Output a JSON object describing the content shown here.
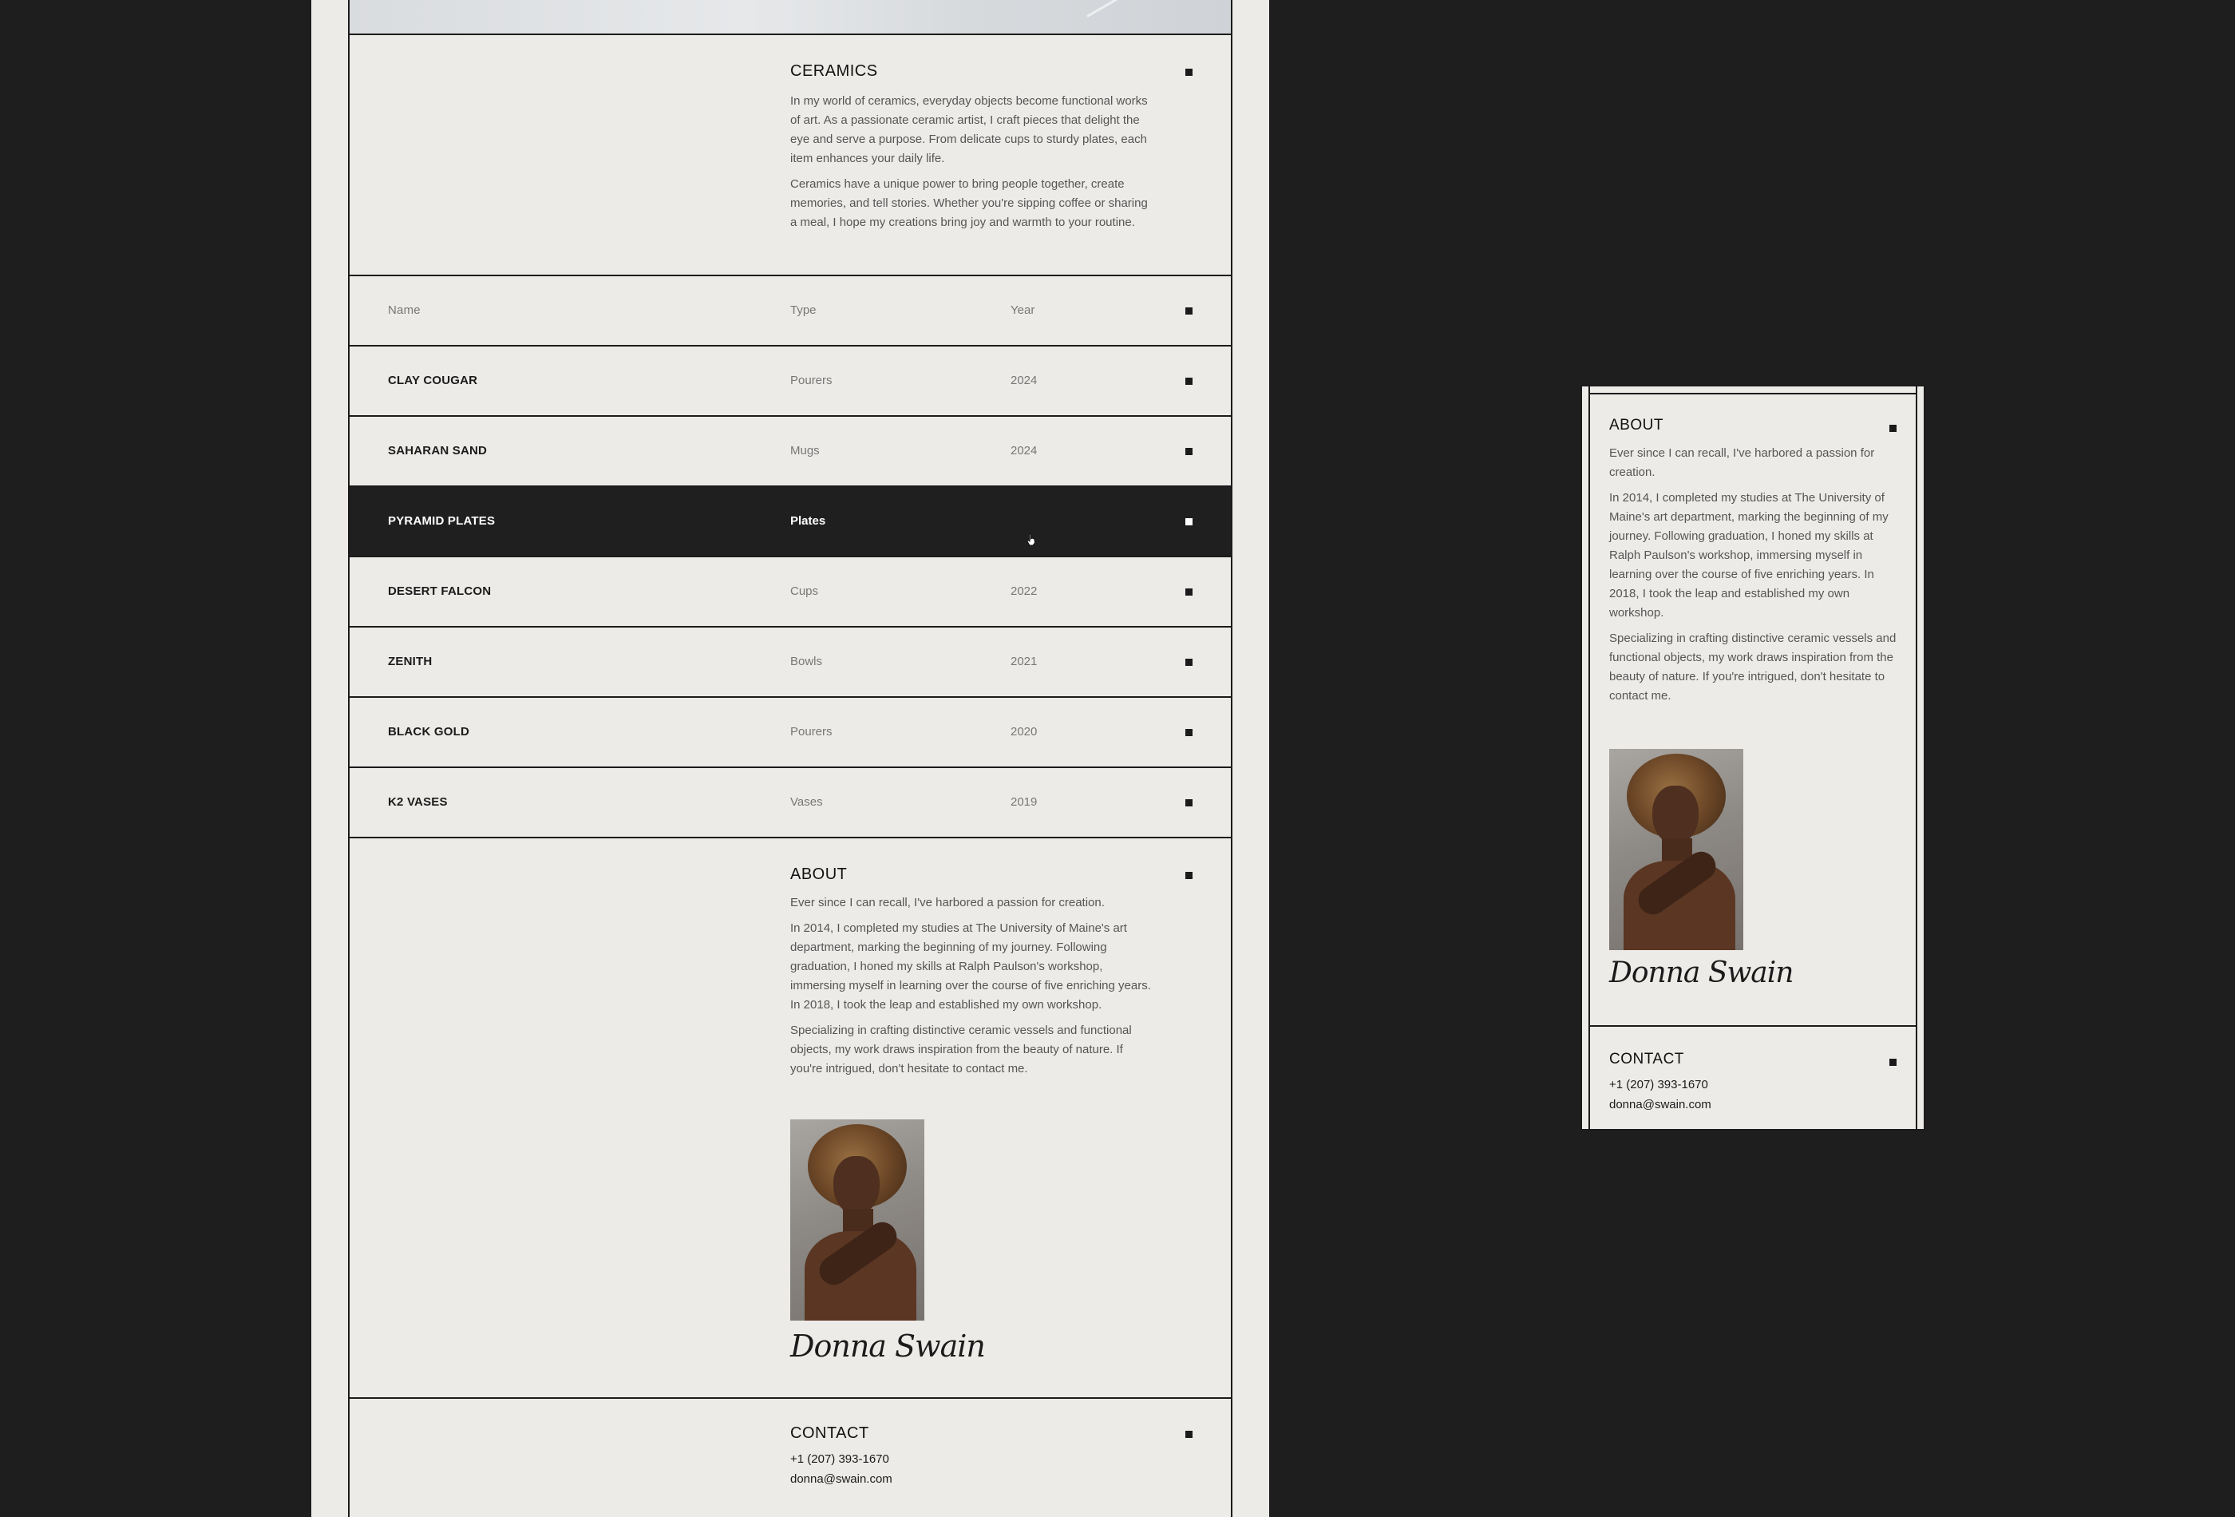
{
  "ceramics": {
    "title": "CERAMICS",
    "paragraphs": [
      "In my world of ceramics, everyday objects become functional works of art. As a passionate ceramic artist, I craft pieces that delight the eye and serve a purpose. From delicate cups to sturdy plates, each item enhances your daily life.",
      "Ceramics have a unique power to bring people together, create memories, and tell stories. Whether you're sipping coffee or sharing a meal, I hope my creations bring joy and warmth to your routine."
    ]
  },
  "table": {
    "headers": {
      "name": "Name",
      "type": "Type",
      "year": "Year"
    },
    "rows": [
      {
        "name": "CLAY COUGAR",
        "type": "Pourers",
        "year": "2024"
      },
      {
        "name": "SAHARAN SAND",
        "type": "Mugs",
        "year": "2024"
      },
      {
        "name": "PYRAMID PLATES",
        "type": "Plates",
        "year": "",
        "highlighted": true
      },
      {
        "name": "DESERT FALCON",
        "type": "Cups",
        "year": "2022"
      },
      {
        "name": "ZENITH",
        "type": "Bowls",
        "year": "2021"
      },
      {
        "name": "BLACK GOLD",
        "type": "Pourers",
        "year": "2020"
      },
      {
        "name": "K2 VASES",
        "type": "Vases",
        "year": "2019"
      }
    ]
  },
  "about": {
    "title": "ABOUT",
    "paragraphs": [
      "Ever since I can recall, I've harbored a passion for creation.",
      "In 2014, I completed my studies at The University of Maine's art department, marking the beginning of my journey. Following graduation, I honed my skills at Ralph Paulson's workshop, immersing myself in learning over the course of five enriching years. In 2018, I took the leap and established my own workshop.",
      "Specializing in crafting distinctive ceramic vessels and functional objects, my work draws inspiration from the beauty of nature. If you're intrigued, don't hesitate to contact me."
    ],
    "signature": "Donna Swain"
  },
  "contact": {
    "title": "CONTACT",
    "phone": "+1 (207) 393-1670",
    "email": "donna@swain.com"
  },
  "icons": {
    "row_marker": "square-bullet-icon",
    "cursor": "hand-pointer-icon"
  },
  "colors": {
    "background": "#edebe8",
    "ink": "#1b1b1b",
    "muted_text": "#777777",
    "highlight_row": "#1f1f1f",
    "backdrop": "#1e1e1e"
  }
}
